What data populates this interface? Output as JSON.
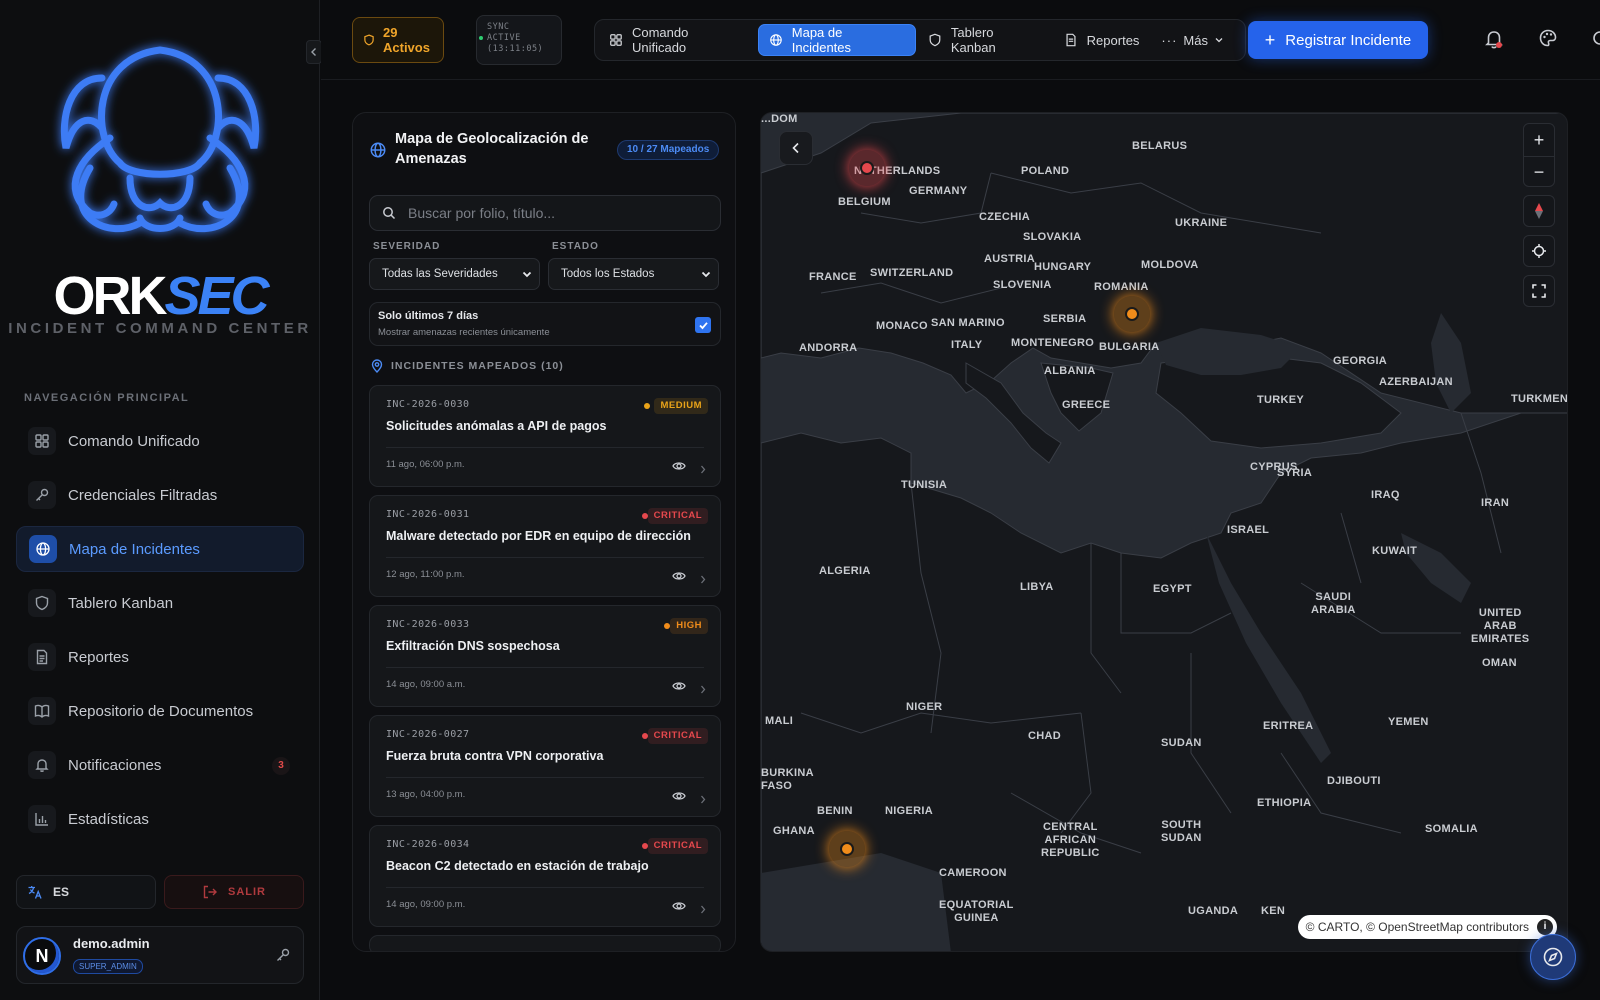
{
  "brand": {
    "name_part1": "ORK",
    "name_part2": "SEC",
    "tagline": "INCIDENT COMMAND CENTER",
    "accent": "#3b82f6"
  },
  "sidebar": {
    "nav_title": "NAVEGACIÓN PRINCIPAL",
    "items": [
      {
        "label": "Comando Unificado",
        "icon": "grid-icon"
      },
      {
        "label": "Credenciales Filtradas",
        "icon": "key-icon"
      },
      {
        "label": "Mapa de Incidentes",
        "icon": "globe-icon",
        "active": true
      },
      {
        "label": "Tablero Kanban",
        "icon": "shield-icon"
      },
      {
        "label": "Reportes",
        "icon": "document-icon"
      },
      {
        "label": "Repositorio de Documentos",
        "icon": "book-icon"
      },
      {
        "label": "Notificaciones",
        "icon": "bell-icon",
        "badge": "3"
      },
      {
        "label": "Estadísticas",
        "icon": "bar-chart-icon"
      }
    ],
    "language": "ES",
    "logout": "SALIR",
    "user": {
      "initial": "N",
      "name": "demo.admin",
      "role": "SUPER_ADMIN"
    }
  },
  "topbar": {
    "active_count": "29",
    "active_label": "Activos",
    "sync_line1": "SYNC",
    "sync_line2": "ACTIVE",
    "sync_time": "(13:11:05)",
    "tabs": [
      "Comando Unificado",
      "Mapa de Incidentes",
      "Tablero Kanban",
      "Reportes",
      "Más"
    ],
    "active_tab": "Mapa de Incidentes",
    "register_label": "Registrar Incidente"
  },
  "panel": {
    "title": "Mapa de Geolocalización de Amenazas",
    "mapped_badge": "10 / 27 Mapeados",
    "search_placeholder": "Buscar por folio, título...",
    "severity_label": "SEVERIDAD",
    "severity_value": "Todas las Severidades",
    "status_label": "ESTADO",
    "status_value": "Todos los Estados",
    "recent_title": "Solo últimos 7 días",
    "recent_sub": "Mostrar amenazas recientes únicamente",
    "recent_checked": true,
    "list_title": "INCIDENTES MAPEADOS (10)",
    "incidents": [
      {
        "id": "INC-2026-0030",
        "severity": "MEDIUM",
        "title": "Solicitudes anómalas a API de pagos",
        "date": "11 ago, 06:00 p.m."
      },
      {
        "id": "INC-2026-0031",
        "severity": "CRITICAL",
        "title": "Malware detectado por EDR en equipo de dirección",
        "date": "12 ago, 11:00 p.m."
      },
      {
        "id": "INC-2026-0033",
        "severity": "HIGH",
        "title": "Exfiltración DNS sospechosa",
        "date": "14 ago, 09:00 a.m."
      },
      {
        "id": "INC-2026-0027",
        "severity": "CRITICAL",
        "title": "Fuerza bruta contra VPN corporativa",
        "date": "13 ago, 04:00 p.m."
      },
      {
        "id": "INC-2026-0034",
        "severity": "CRITICAL",
        "title": "Beacon C2 detectado en estación de trabajo",
        "date": "14 ago, 09:00 p.m."
      }
    ]
  },
  "severity_colors": {
    "MEDIUM": "#e9a319",
    "CRITICAL": "#e5484d",
    "HIGH": "#f08c1b"
  },
  "map": {
    "labels": [
      "...DOM",
      "NETHERLANDS",
      "BELGIUM",
      "GERMANY",
      "POLAND",
      "BELARUS",
      "UKRAINE",
      "CZECHIA",
      "SLOVAKIA",
      "AUSTRIA",
      "HUNGARY",
      "MOLDOVA",
      "FRANCE",
      "SWITZERLAND",
      "SLOVENIA",
      "ROMANIA",
      "MONACO",
      "SAN MARINO",
      "SERBIA",
      "ANDORRA",
      "ITALY",
      "MONTENEGRO",
      "BULGARIA",
      "ALBANIA",
      "GEORGIA",
      "AZERBAIJAN",
      "GREECE",
      "TURKEY",
      "TURKMEN",
      "CYPRUS",
      "SYRIA",
      "TUNISIA",
      "IRAQ",
      "IRAN",
      "ISRAEL",
      "KUWAIT",
      "ALGERIA",
      "LIBYA",
      "EGYPT",
      "SAUDI ARABIA",
      "UNITED ARAB EMIRATES",
      "OMAN",
      "NIGER",
      "MALI",
      "CHAD",
      "ERITREA",
      "YEMEN",
      "SUDAN",
      "DJIBOUTI",
      "BURKINA FASO",
      "BENIN",
      "NIGERIA",
      "ETHIOPIA",
      "GHANA",
      "SOMALIA",
      "CENTRAL AFRICAN REPUBLIC",
      "SOUTH SUDAN",
      "CAMEROON",
      "EQUATORIAL GUINEA",
      "UGANDA",
      "KEN"
    ],
    "attribution": "© CARTO, © OpenStreetMap contributors",
    "markers": [
      {
        "severity": "CRITICAL",
        "place": "NETHERLANDS"
      },
      {
        "severity": "HIGH",
        "place": "BULGARIA"
      },
      {
        "severity": "HIGH",
        "place": "GHANA"
      }
    ]
  }
}
